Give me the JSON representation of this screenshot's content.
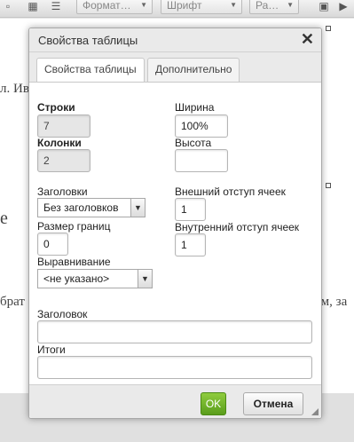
{
  "toolbar": {
    "format_label": "Формат…",
    "font_label": "Шрифт",
    "size_label": "Ра…"
  },
  "background": {
    "line1": "л. Ив",
    "line2": "е",
    "line3": "брат",
    "line4": "ем, за"
  },
  "dialog": {
    "title": "Свойства таблицы",
    "close_glyph": "✕",
    "tabs": [
      {
        "label": "Свойства таблицы",
        "active": true
      },
      {
        "label": "Дополнительно",
        "active": false
      }
    ],
    "rows_label": "Строки",
    "rows_value": "7",
    "cols_label": "Колонки",
    "cols_value": "2",
    "width_label": "Ширина",
    "width_value": "100%",
    "height_label": "Высота",
    "height_value": "",
    "headers_label": "Заголовки",
    "headers_selected": "Без заголовков",
    "border_label": "Размер границ",
    "border_value": "0",
    "outer_pad_label": "Внешний отступ ячеек",
    "outer_pad_value": "1",
    "inner_pad_label": "Внутренний отступ ячеек",
    "inner_pad_value": "1",
    "align_label": "Выравнивание",
    "align_selected": "<не указано>",
    "caption_label": "Заголовок",
    "caption_value": "",
    "summary_label": "Итоги",
    "summary_value": "",
    "ok_label": "OK",
    "cancel_label": "Отмена"
  },
  "colors": {
    "ok_button": "#6aae2a",
    "dialog_chrome": "#eaeaea"
  }
}
